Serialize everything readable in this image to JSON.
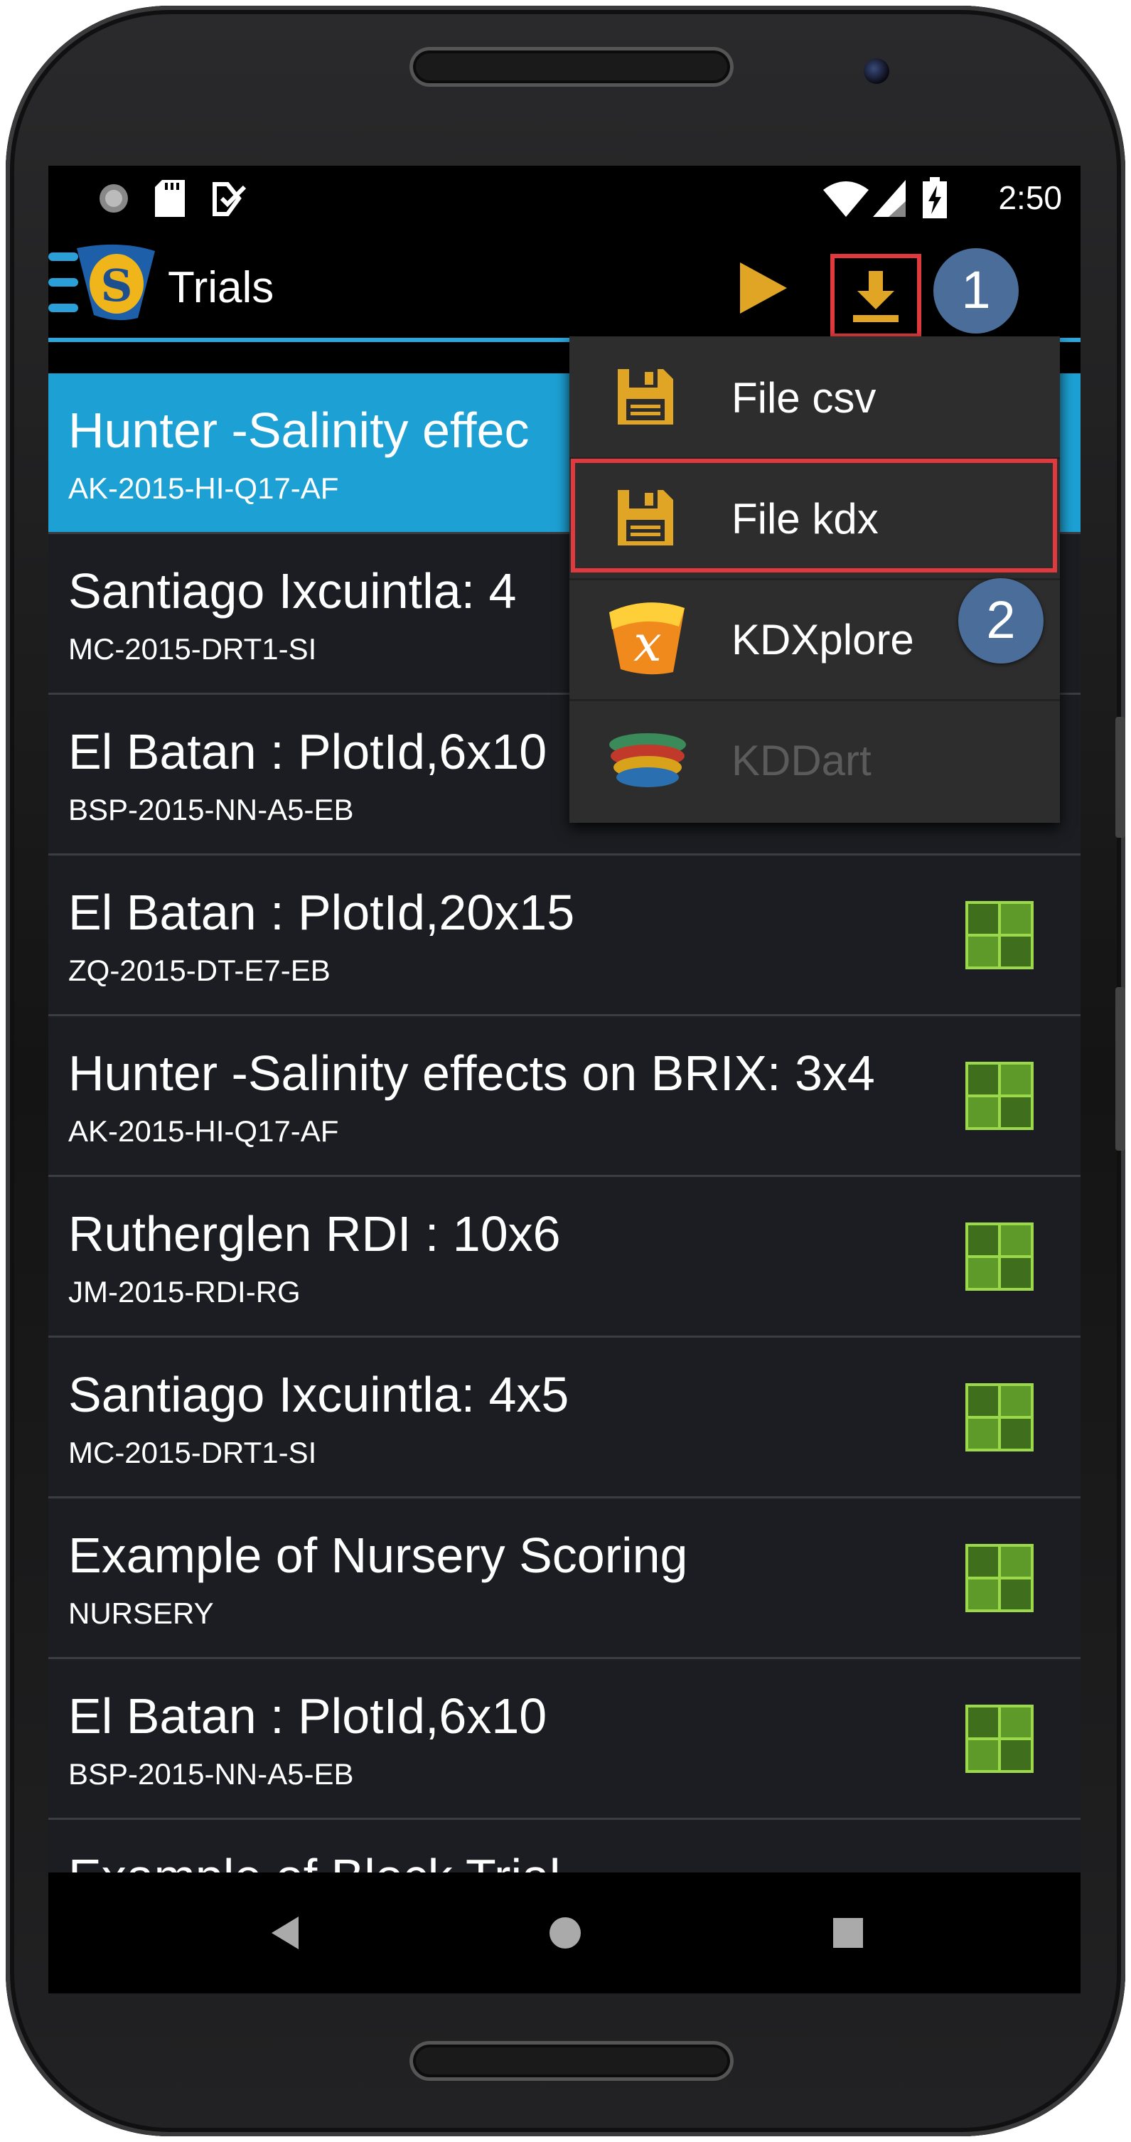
{
  "status_bar": {
    "time": "2:50",
    "icons": [
      "sync-icon",
      "sd-card-icon",
      "notification-icon",
      "wifi-icon",
      "signal-icon",
      "battery-charging-icon"
    ]
  },
  "app_bar": {
    "title": "Trials",
    "accent_color": "#29a8e0",
    "actions": [
      "play-icon",
      "download-icon"
    ]
  },
  "callouts": {
    "step1": "1",
    "step2": "2"
  },
  "export_menu": {
    "items": [
      {
        "label": "File csv",
        "icon": "save-icon",
        "enabled": true
      },
      {
        "label": "File kdx",
        "icon": "save-icon",
        "enabled": true,
        "highlighted": true
      },
      {
        "label": "KDXplore",
        "icon": "kdxplore-logo",
        "enabled": true
      },
      {
        "label": "KDDart",
        "icon": "kddart-logo",
        "enabled": false
      }
    ]
  },
  "trials": [
    {
      "title": "Hunter -Salinity effec",
      "subtitle": "AK-2015-HI-Q17-AF",
      "selected": true
    },
    {
      "title": "Santiago Ixcuintla: 4",
      "subtitle": "MC-2015-DRT1-SI"
    },
    {
      "title": "El Batan : PlotId,6x10",
      "subtitle": "BSP-2015-NN-A5-EB"
    },
    {
      "title": "El Batan : PlotId,20x15",
      "subtitle": "ZQ-2015-DT-E7-EB"
    },
    {
      "title": "Hunter -Salinity effects on BRIX: 3x4",
      "subtitle": "AK-2015-HI-Q17-AF"
    },
    {
      "title": "Rutherglen RDI : 10x6",
      "subtitle": "JM-2015-RDI-RG"
    },
    {
      "title": "Santiago Ixcuintla: 4x5",
      "subtitle": "MC-2015-DRT1-SI"
    },
    {
      "title": "Example of Nursery Scoring",
      "subtitle": "NURSERY"
    },
    {
      "title": "El Batan : PlotId,6x10",
      "subtitle": "BSP-2015-NN-A5-EB"
    },
    {
      "title": "Example of Block Trial",
      "subtitle": ""
    }
  ],
  "nav_bar": [
    "back-icon",
    "home-icon",
    "recents-icon"
  ]
}
